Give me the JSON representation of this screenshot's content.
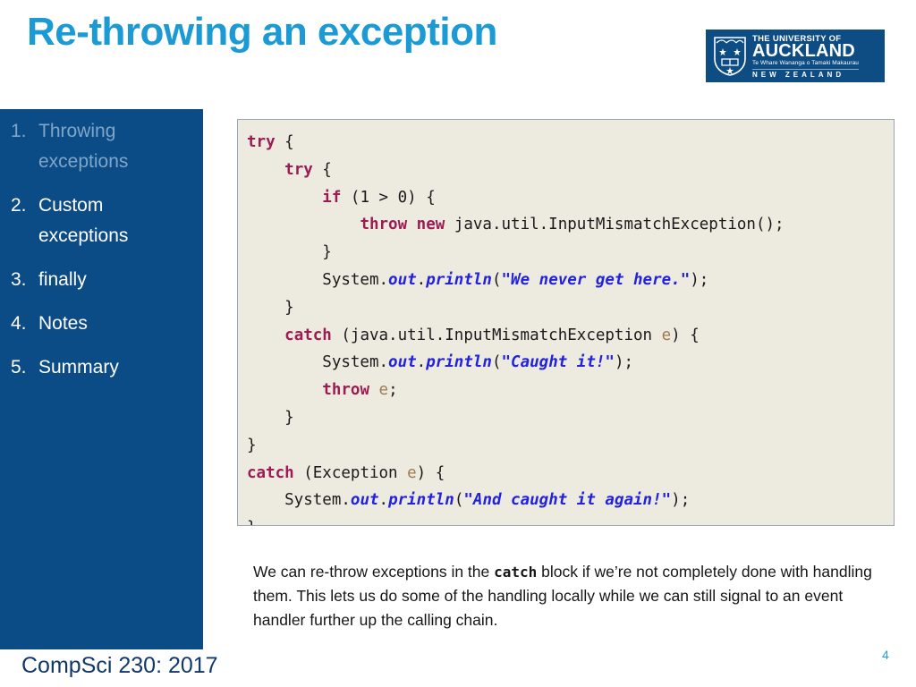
{
  "slide": {
    "title": "Re-throwing an exception",
    "page_number": "4",
    "footer_course": "CompSci 230: 2017",
    "accent_title_color": "#1C9AD4",
    "sidebar_color": "#0C4C86",
    "code_bg_color": "#EDEBE0"
  },
  "logo": {
    "line1": "THE UNIVERSITY OF",
    "line2": "AUCKLAND",
    "line3": "Te Whare Wananga o Tamaki Makaurau",
    "line4": "NEW ZEALAND"
  },
  "sidebar": {
    "items": [
      {
        "num": "1.",
        "label": "Throwing exceptions",
        "state": "dim"
      },
      {
        "num": "2.",
        "label": "Custom exceptions",
        "state": "normal"
      },
      {
        "num": "3.",
        "label": "finally",
        "state": "normal"
      },
      {
        "num": "4.",
        "label": "Notes",
        "state": "normal"
      },
      {
        "num": "5.",
        "label": "Summary",
        "state": "normal"
      }
    ]
  },
  "code": {
    "language": "java",
    "lines": [
      [
        {
          "t": "try",
          "c": "kw"
        },
        {
          "t": " {",
          "c": "plain"
        }
      ],
      [
        {
          "t": "    ",
          "c": "plain"
        },
        {
          "t": "try",
          "c": "kw"
        },
        {
          "t": " {",
          "c": "plain"
        }
      ],
      [
        {
          "t": "        ",
          "c": "plain"
        },
        {
          "t": "if",
          "c": "kw"
        },
        {
          "t": " (1 > 0) {",
          "c": "plain"
        }
      ],
      [
        {
          "t": "            ",
          "c": "plain"
        },
        {
          "t": "throw",
          "c": "kw"
        },
        {
          "t": " ",
          "c": "plain"
        },
        {
          "t": "new",
          "c": "kw"
        },
        {
          "t": " java.util.InputMismatchException();",
          "c": "plain"
        }
      ],
      [
        {
          "t": "        }",
          "c": "plain"
        }
      ],
      [
        {
          "t": "        System.",
          "c": "plain"
        },
        {
          "t": "out",
          "c": "member"
        },
        {
          "t": ".",
          "c": "plain"
        },
        {
          "t": "println",
          "c": "member"
        },
        {
          "t": "(",
          "c": "plain"
        },
        {
          "t": "\"We never get here.\"",
          "c": "str"
        },
        {
          "t": ");",
          "c": "plain"
        }
      ],
      [
        {
          "t": "    }",
          "c": "plain"
        }
      ],
      [
        {
          "t": "    ",
          "c": "plain"
        },
        {
          "t": "catch",
          "c": "kw"
        },
        {
          "t": " (java.util.InputMismatchException ",
          "c": "plain"
        },
        {
          "t": "e",
          "c": "var"
        },
        {
          "t": ") {",
          "c": "plain"
        }
      ],
      [
        {
          "t": "        System.",
          "c": "plain"
        },
        {
          "t": "out",
          "c": "member"
        },
        {
          "t": ".",
          "c": "plain"
        },
        {
          "t": "println",
          "c": "member"
        },
        {
          "t": "(",
          "c": "plain"
        },
        {
          "t": "\"Caught it!\"",
          "c": "str"
        },
        {
          "t": ");",
          "c": "plain"
        }
      ],
      [
        {
          "t": "        ",
          "c": "plain"
        },
        {
          "t": "throw",
          "c": "kw"
        },
        {
          "t": " ",
          "c": "plain"
        },
        {
          "t": "e",
          "c": "var"
        },
        {
          "t": ";",
          "c": "plain"
        }
      ],
      [
        {
          "t": "    }",
          "c": "plain"
        }
      ],
      [
        {
          "t": "}",
          "c": "plain"
        }
      ],
      [
        {
          "t": "catch",
          "c": "kw"
        },
        {
          "t": " (Exception ",
          "c": "plain"
        },
        {
          "t": "e",
          "c": "var"
        },
        {
          "t": ") {",
          "c": "plain"
        }
      ],
      [
        {
          "t": "    System.",
          "c": "plain"
        },
        {
          "t": "out",
          "c": "member"
        },
        {
          "t": ".",
          "c": "plain"
        },
        {
          "t": "println",
          "c": "member"
        },
        {
          "t": "(",
          "c": "plain"
        },
        {
          "t": "\"And caught it again!\"",
          "c": "str"
        },
        {
          "t": ");",
          "c": "plain"
        }
      ],
      [
        {
          "t": "}",
          "c": "plain"
        }
      ]
    ]
  },
  "body": {
    "parts": [
      {
        "t": "We can re-throw exceptions in the ",
        "mono": false
      },
      {
        "t": "catch",
        "mono": true
      },
      {
        "t": " block if we’re not completely done with handling them. This lets us do some of the handling locally while we can still signal to an event handler further up the calling chain.",
        "mono": false
      }
    ]
  }
}
